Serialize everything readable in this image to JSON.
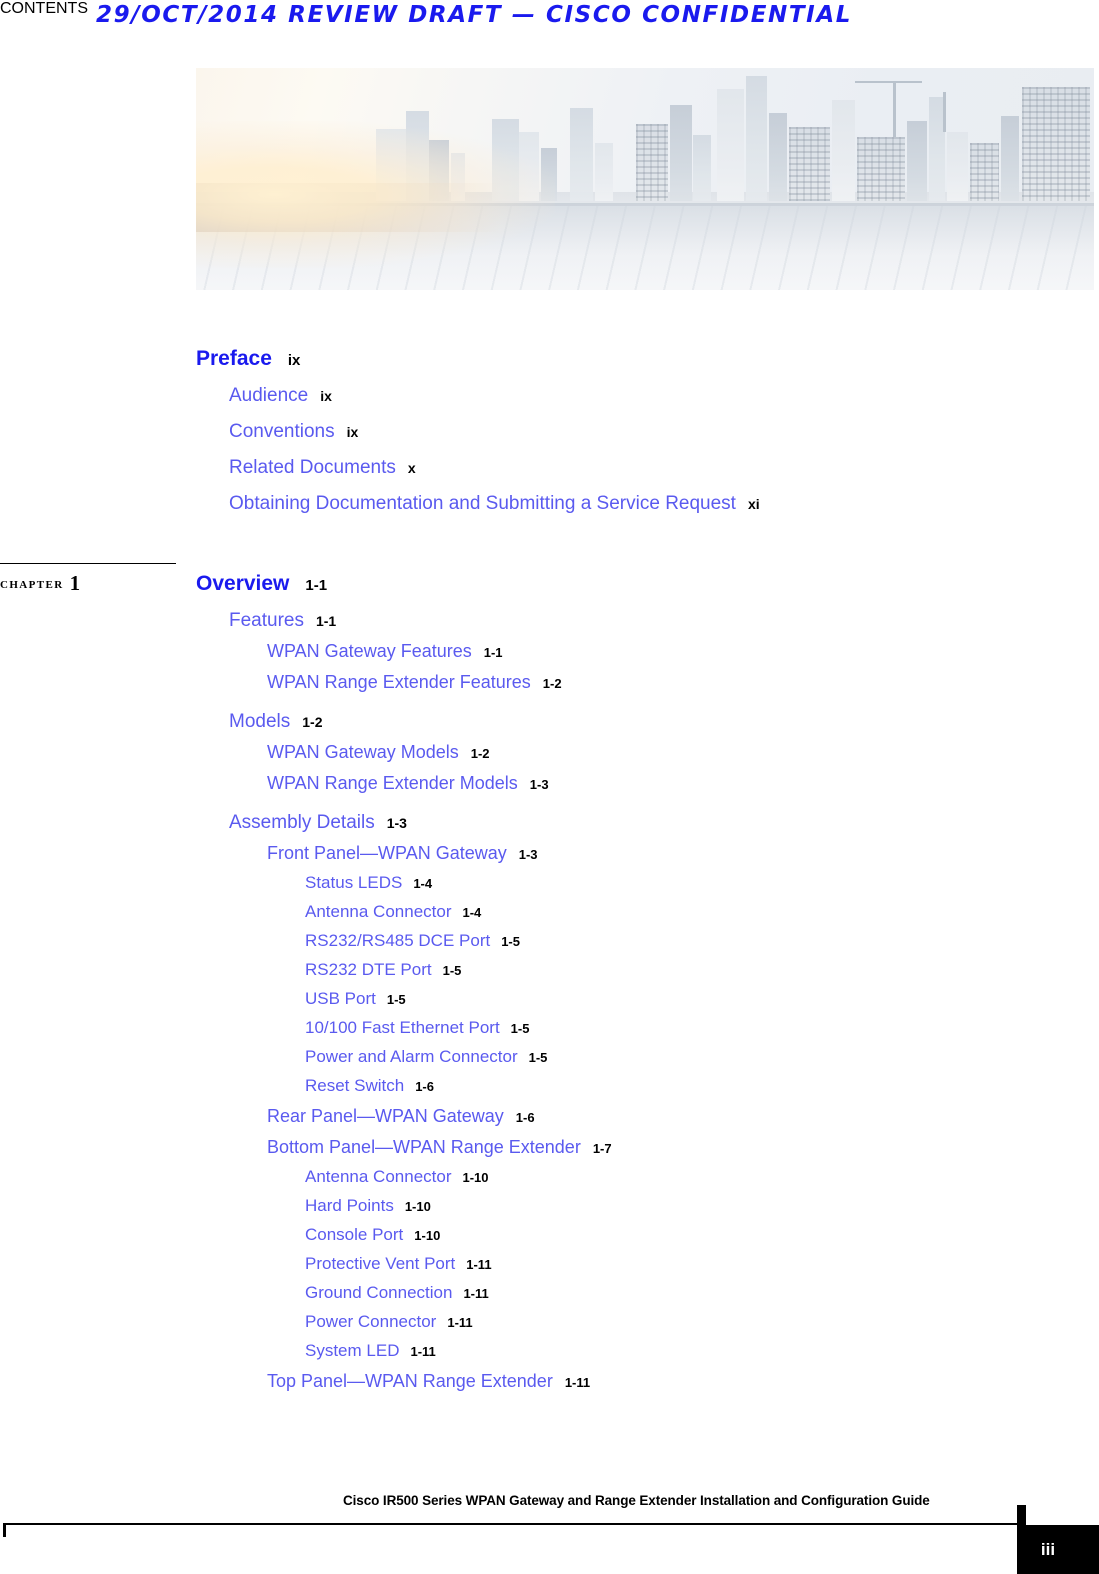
{
  "header": {
    "draft_notice": "29/OCT/2014 REVIEW DRAFT — CISCO CONFIDENTIAL"
  },
  "banner": {
    "word": "CONTENTS",
    "image_description": "city-skyline-photo"
  },
  "chapter_marker": {
    "label": "CHAPTER",
    "number": "1"
  },
  "toc": {
    "entries": [
      {
        "level": 0,
        "title": "Preface",
        "page": "ix"
      },
      {
        "level": 1,
        "title": "Audience",
        "page": "ix"
      },
      {
        "level": 1,
        "title": "Conventions",
        "page": "ix"
      },
      {
        "level": 1,
        "title": "Related Documents",
        "page": "x"
      },
      {
        "level": 1,
        "title": "Obtaining Documentation and Submitting a Service Request",
        "page": "xi"
      },
      {
        "level": 0,
        "title": "Overview",
        "page": "1-1"
      },
      {
        "level": 1,
        "title": "Features",
        "page": "1-1"
      },
      {
        "level": 2,
        "title": "WPAN Gateway Features",
        "page": "1-1"
      },
      {
        "level": 2,
        "title": "WPAN Range Extender Features",
        "page": "1-2"
      },
      {
        "level": 1,
        "title": "Models",
        "page": "1-2"
      },
      {
        "level": 2,
        "title": "WPAN Gateway Models",
        "page": "1-2"
      },
      {
        "level": 2,
        "title": "WPAN Range Extender Models",
        "page": "1-3"
      },
      {
        "level": 1,
        "title": "Assembly Details",
        "page": "1-3"
      },
      {
        "level": 2,
        "title": "Front Panel—WPAN Gateway",
        "page": "1-3"
      },
      {
        "level": 3,
        "title": "Status LEDS",
        "page": "1-4"
      },
      {
        "level": 3,
        "title": "Antenna Connector",
        "page": "1-4"
      },
      {
        "level": 3,
        "title": "RS232/RS485 DCE Port",
        "page": "1-5"
      },
      {
        "level": 3,
        "title": "RS232 DTE Port",
        "page": "1-5"
      },
      {
        "level": 3,
        "title": "USB Port",
        "page": "1-5"
      },
      {
        "level": 3,
        "title": "10/100 Fast Ethernet Port",
        "page": "1-5"
      },
      {
        "level": 3,
        "title": "Power and Alarm Connector",
        "page": "1-5"
      },
      {
        "level": 3,
        "title": "Reset Switch",
        "page": "1-6"
      },
      {
        "level": 2,
        "title": "Rear Panel—WPAN Gateway",
        "page": "1-6"
      },
      {
        "level": 2,
        "title": "Bottom Panel—WPAN Range Extender",
        "page": "1-7"
      },
      {
        "level": 3,
        "title": "Antenna Connector",
        "page": "1-10"
      },
      {
        "level": 3,
        "title": "Hard Points",
        "page": "1-10"
      },
      {
        "level": 3,
        "title": "Console Port",
        "page": "1-10"
      },
      {
        "level": 3,
        "title": "Protective Vent Port",
        "page": "1-11"
      },
      {
        "level": 3,
        "title": "Ground Connection",
        "page": "1-11"
      },
      {
        "level": 3,
        "title": "Power Connector",
        "page": "1-11"
      },
      {
        "level": 3,
        "title": "System LED",
        "page": "1-11"
      },
      {
        "level": 2,
        "title": "Top Panel—WPAN Range Extender",
        "page": "1-11"
      }
    ]
  },
  "footer": {
    "title": "Cisco IR500 Series WPAN Gateway and Range Extender Installation and Configuration Guide",
    "page_number": "iii"
  },
  "colors": {
    "draft_blue": "#1a1aee",
    "heading_blue": "#1a1aee",
    "entry_blue": "#5a5aef",
    "page_black": "#000000"
  }
}
